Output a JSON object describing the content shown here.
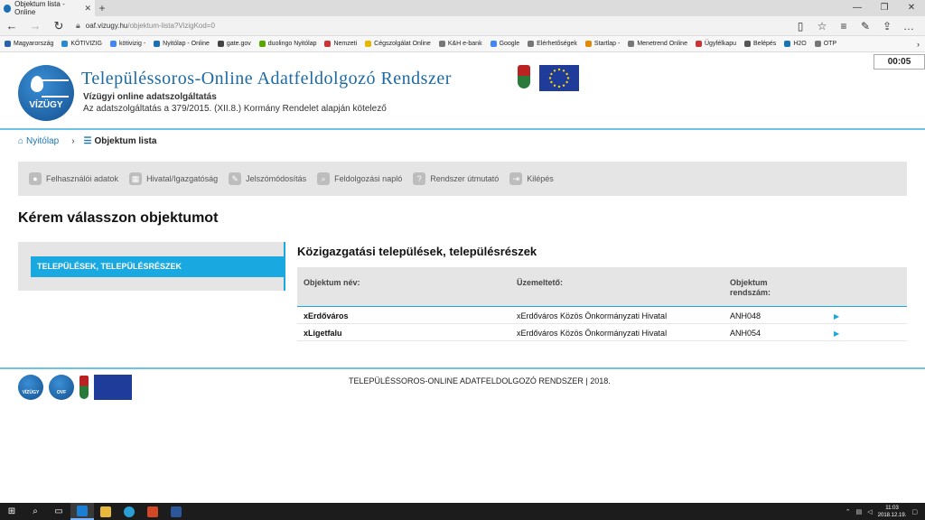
{
  "browser": {
    "tab_title": "Objektum lista - Online",
    "url_domain": "oaf.vizugy.hu",
    "url_path": "/objektum-lista?VizigKod=0",
    "favorites": [
      {
        "label": "Magyarország",
        "color": "#2a62b0"
      },
      {
        "label": "KÖTIVIZIG",
        "color": "#2a8ad0"
      },
      {
        "label": "kötivizig -",
        "color": "#4285f4"
      },
      {
        "label": "Nyitólap - Online",
        "color": "#1b6fb5"
      },
      {
        "label": "gate.gov",
        "color": "#444"
      },
      {
        "label": "duolingo Nyitólap",
        "color": "#58a700"
      },
      {
        "label": "Nemzeti",
        "color": "#c33"
      },
      {
        "label": "Cégszolgálat Online",
        "color": "#e6b800"
      },
      {
        "label": "K&H e-bank",
        "color": "#777"
      },
      {
        "label": "Google",
        "color": "#4285f4"
      },
      {
        "label": "Elérhetőségek",
        "color": "#777"
      },
      {
        "label": "Startlap -",
        "color": "#e08a00"
      },
      {
        "label": "Menetrend Online",
        "color": "#777"
      },
      {
        "label": "Ügyfélkapu",
        "color": "#c33"
      },
      {
        "label": "Belépés",
        "color": "#555"
      },
      {
        "label": "H2O",
        "color": "#1a75b5"
      },
      {
        "label": "OTP",
        "color": "#777"
      }
    ]
  },
  "timer": "00:05",
  "header": {
    "logo_text": "VÍZÜGY",
    "title": "Településsoros-Online Adatfeldolgozó Rendszer",
    "subtitle1": "Vízügyi online adatszolgáltatás",
    "subtitle2": "Az adatszolgáltatás a 379/2015. (XII.8.) Kormány Rendelet alapján kötelező"
  },
  "breadcrumb": {
    "home": "Nyitólap",
    "current": "Objektum lista"
  },
  "menu": [
    {
      "label": "Felhasználói adatok",
      "icon": "user-icon"
    },
    {
      "label": "Hivatal/Igazgatóság",
      "icon": "building-icon"
    },
    {
      "label": "Jelszómódosítás",
      "icon": "wrench-icon"
    },
    {
      "label": "Feldolgozási napló",
      "icon": "search-icon"
    },
    {
      "label": "Rendszer útmutató",
      "icon": "help-icon"
    },
    {
      "label": "Kilépés",
      "icon": "logout-icon"
    }
  ],
  "main": {
    "heading": "Kérem válasszon objektumot",
    "sidebar_item": "TELEPÜLÉSEK, TELEPÜLÉSRÉSZEK",
    "section_title": "Közigazgatási települések, településrészek",
    "table": {
      "headers": [
        "Objektum név:",
        "Üzemeltető:",
        "Objektum",
        "rendszám:"
      ],
      "rows": [
        {
          "name": "xErdőváros",
          "operator": "xErdőváros Közös Önkormányzati Hivatal",
          "code": "ANH048"
        },
        {
          "name": "xLigetfalu",
          "operator": "xErdőváros Közös Önkormányzati Hivatal",
          "code": "ANH054"
        }
      ]
    }
  },
  "footer": {
    "text": "TELEPÜLÉSSOROS-ONLINE ADATFELDOLGOZÓ RENDSZER | 2018.",
    "logo2_text": "OVF"
  },
  "taskbar": {
    "time": "11:03",
    "date": "2018.12.19."
  }
}
